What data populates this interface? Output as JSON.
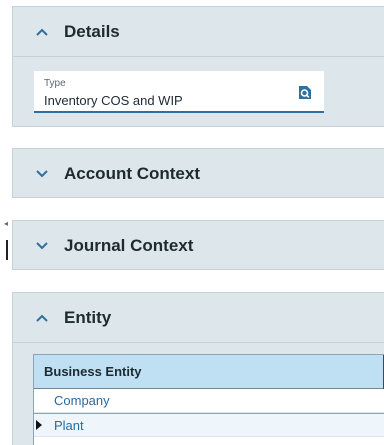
{
  "sections": {
    "details": {
      "title": "Details",
      "expanded": true
    },
    "account_context": {
      "title": "Account Context",
      "expanded": false
    },
    "journal_context": {
      "title": "Journal Context",
      "expanded": false
    },
    "entity": {
      "title": "Entity",
      "expanded": true
    }
  },
  "type_field": {
    "label": "Type",
    "value": "Inventory COS and WIP"
  },
  "entity_grid": {
    "column_header": "Business Entity",
    "rows": [
      "Company",
      "Plant"
    ],
    "selected_row": 2
  },
  "colors": {
    "panel": "#dde6ea",
    "header_fill": "#bfe0f3",
    "link": "#2a6aa3",
    "field_underline": "#2f6f9f"
  },
  "icons": {
    "collapse": "chevron-up-icon",
    "expand": "chevron-down-icon",
    "lookup": "search-document-icon",
    "row_pointer": "right-triangle-icon"
  }
}
